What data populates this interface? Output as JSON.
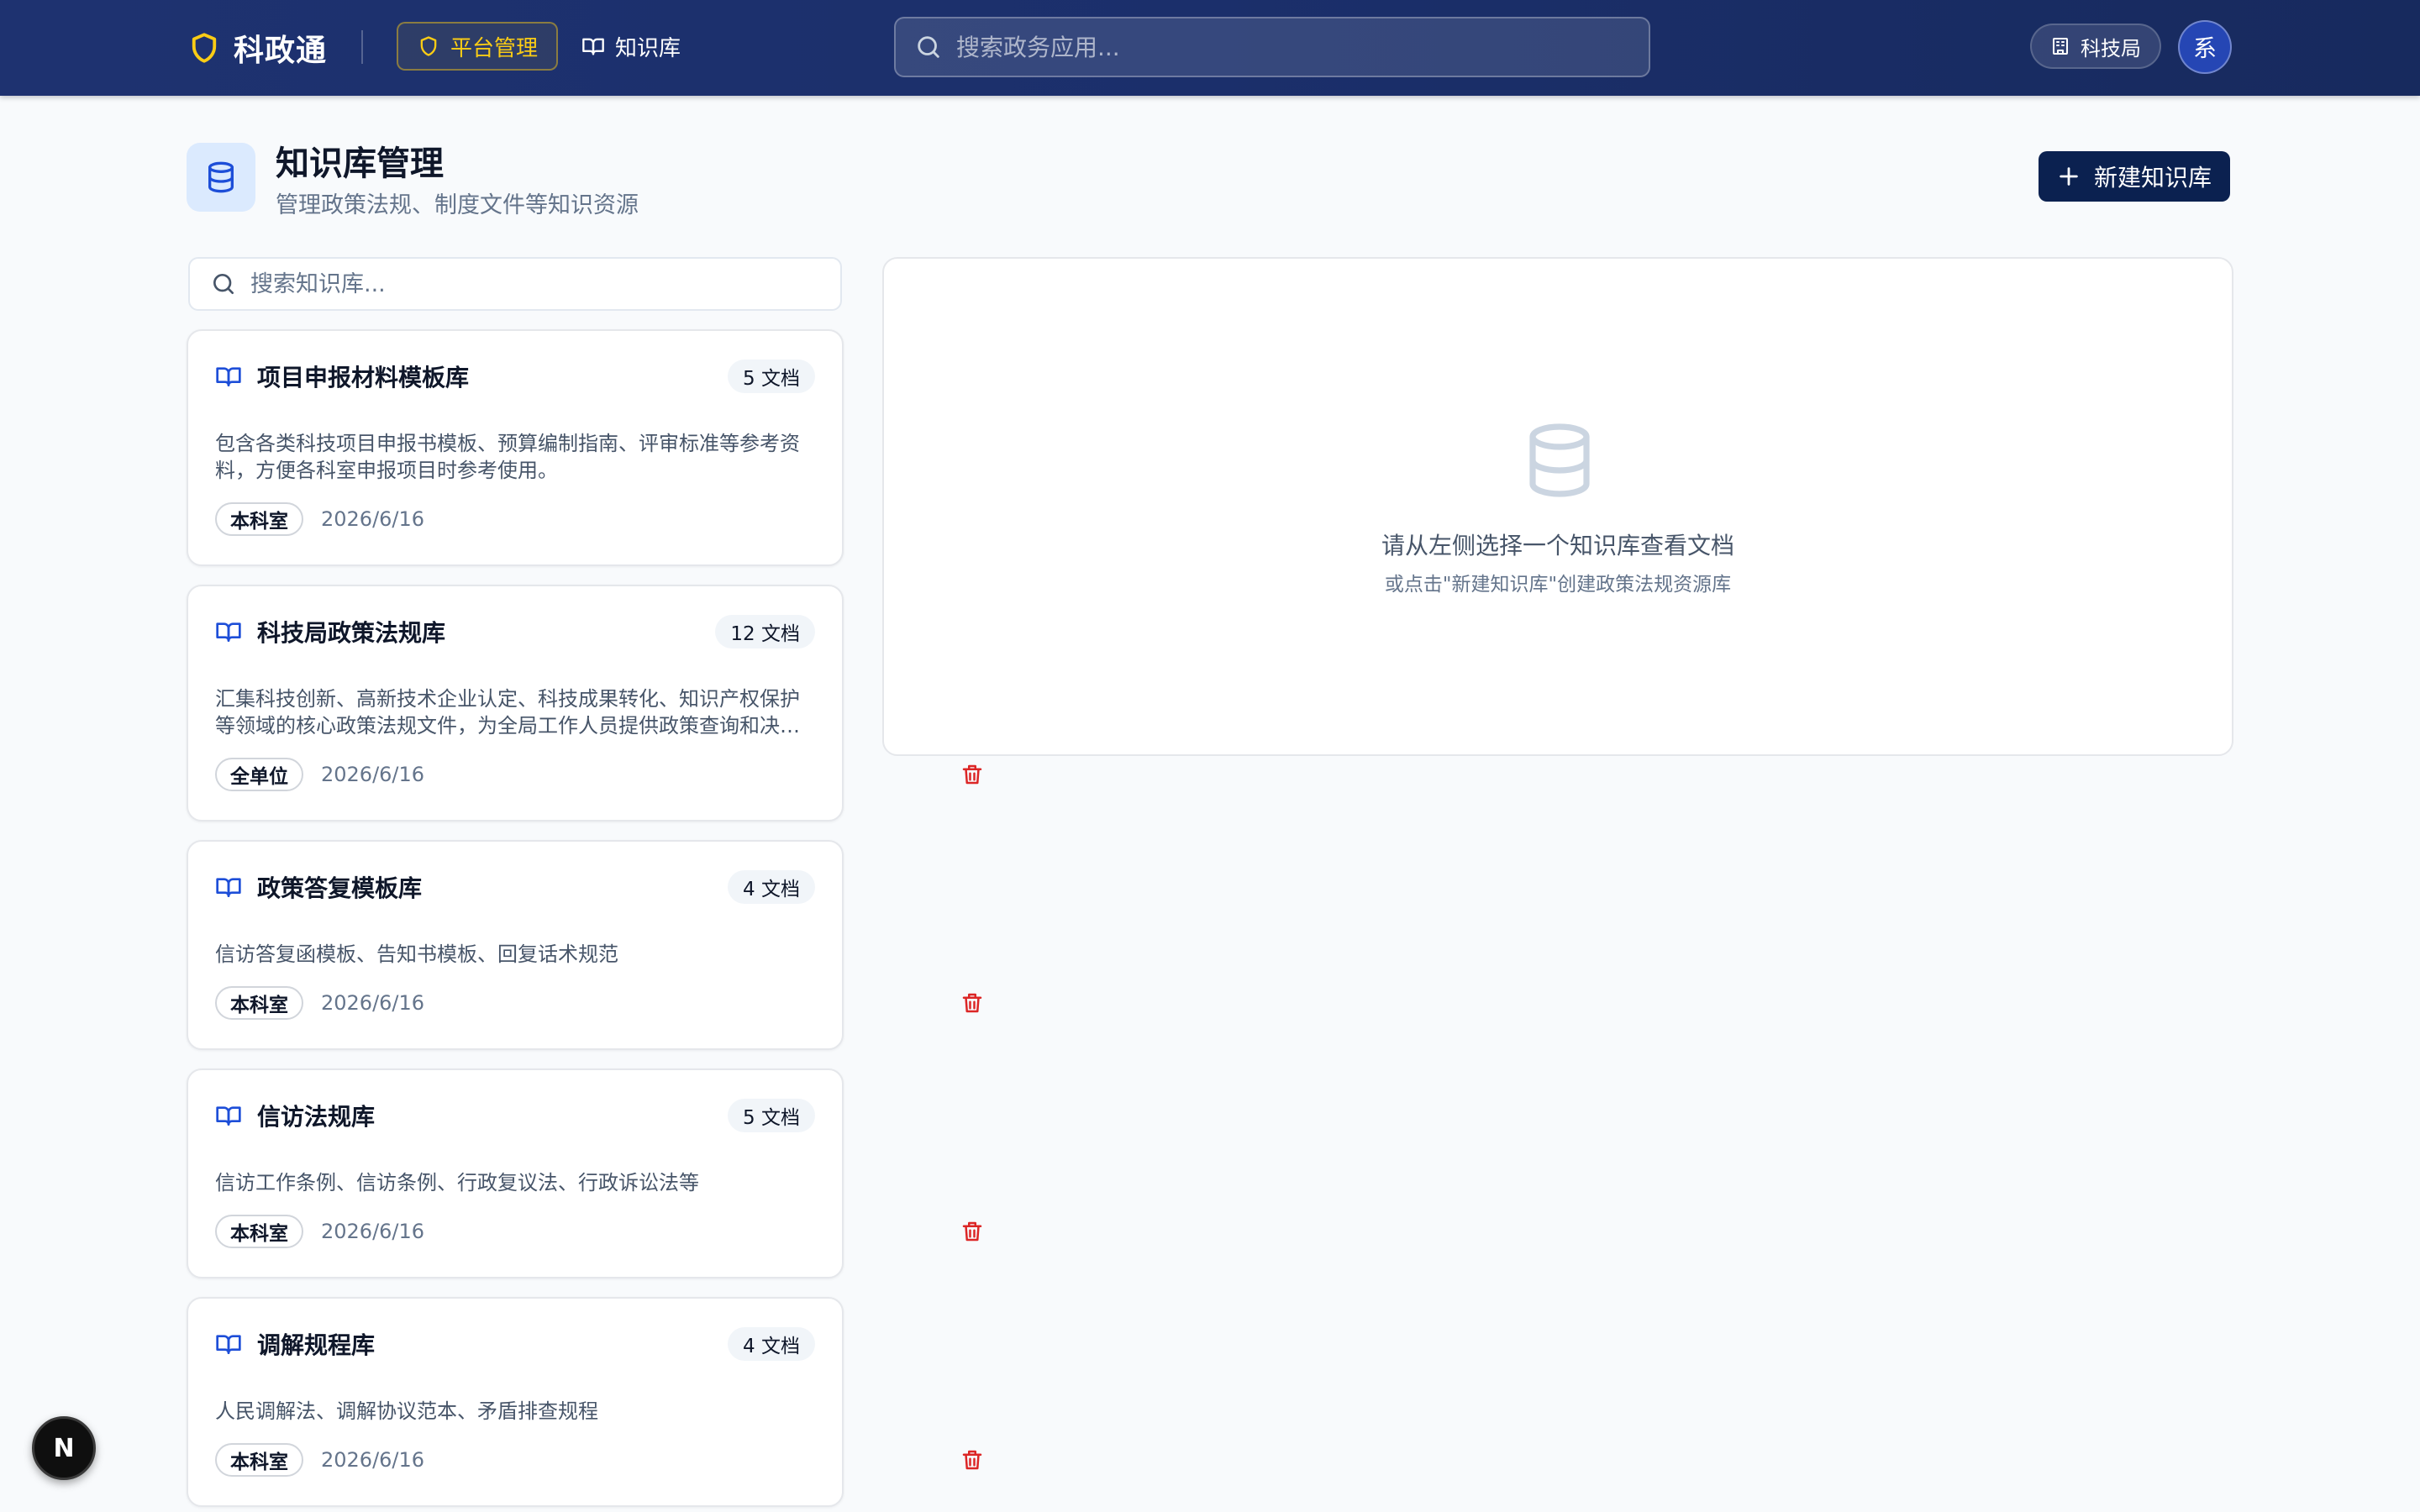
{
  "brand": {
    "name": "科政通"
  },
  "nav": {
    "platform_label": "平台管理",
    "kb_label": "知识库"
  },
  "top_search": {
    "placeholder": "搜索政务应用..."
  },
  "user": {
    "department": "科技局",
    "avatar_initial": "系"
  },
  "page": {
    "title": "知识库管理",
    "subtitle": "管理政策法规、制度文件等知识资源",
    "new_button_label": "新建知识库"
  },
  "kb_search": {
    "placeholder": "搜索知识库..."
  },
  "knowledge_bases": [
    {
      "title": "项目申报材料模板库",
      "count": "5 文档",
      "description": "包含各类科技项目申报书模板、预算编制指南、评审标准等参考资料，方便各科室申报项目时参考使用。",
      "scope": "本科室",
      "date": "2026/6/16"
    },
    {
      "title": "科技局政策法规库",
      "count": "12 文档",
      "description": "汇集科技创新、高新技术企业认定、科技成果转化、知识产权保护等领域的核心政策法规文件，为全局工作人员提供政策查询和决策支持。",
      "scope": "全单位",
      "date": "2026/6/16"
    },
    {
      "title": "政策答复模板库",
      "count": "4 文档",
      "description": "信访答复函模板、告知书模板、回复话术规范",
      "scope": "本科室",
      "date": "2026/6/16"
    },
    {
      "title": "信访法规库",
      "count": "5 文档",
      "description": "信访工作条例、信访条例、行政复议法、行政诉讼法等",
      "scope": "本科室",
      "date": "2026/6/16"
    },
    {
      "title": "调解规程库",
      "count": "4 文档",
      "description": "人民调解法、调解协议范本、矛盾排查规程",
      "scope": "本科室",
      "date": "2026/6/16"
    }
  ],
  "empty_state": {
    "title": "请从左侧选择一个知识库查看文档",
    "subtitle": "或点击\"新建知识库\"创建政策法规资源库"
  },
  "dev_badge": {
    "label": "N"
  },
  "colors": {
    "header_bg": "#1b2f6b",
    "accent_yellow": "#facc15",
    "primary_button": "#0b2150",
    "link_blue": "#1d4ed8",
    "delete_red": "#dc2626"
  },
  "icons": {
    "brand": "shield-icon",
    "platform": "shield-icon",
    "kb": "book-open-icon",
    "search": "search-icon",
    "department": "building-icon",
    "page": "database-icon",
    "new": "plus-icon",
    "delete": "trash-icon"
  }
}
